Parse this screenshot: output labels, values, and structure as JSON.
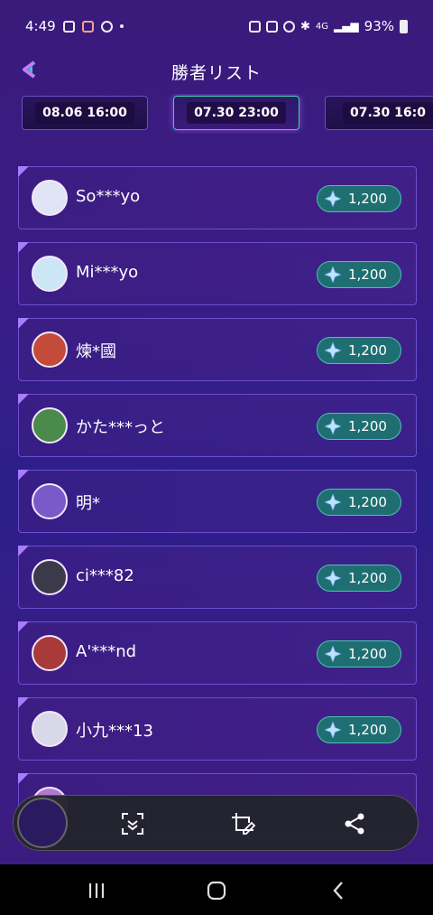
{
  "status_bar": {
    "time": "4:49",
    "battery": "93%",
    "network": "4G"
  },
  "header": {
    "title": "勝者リスト"
  },
  "tabs": [
    "08.06 16:00",
    "07.30 23:00",
    "07.30 16:0"
  ],
  "winners": [
    {
      "name": "So***yo",
      "prize": "1,200",
      "avatar_color": "#e0e4f4"
    },
    {
      "name": "Mi***yo",
      "prize": "1,200",
      "avatar_color": "#cde6f5"
    },
    {
      "name": "煉*國",
      "prize": "1,200",
      "avatar_color": "#c44a3a"
    },
    {
      "name": "かた***っと",
      "prize": "1,200",
      "avatar_color": "#4a8a4a"
    },
    {
      "name": "明*",
      "prize": "1,200",
      "avatar_color": "#7a5ac8"
    },
    {
      "name": "ci***82",
      "prize": "1,200",
      "avatar_color": "#3a3a4a"
    },
    {
      "name": "A'***nd",
      "prize": "1,200",
      "avatar_color": "#a83a3a"
    },
    {
      "name": "小九***13",
      "prize": "1,200",
      "avatar_color": "#d8d8e8"
    },
    {
      "name": "",
      "prize": "",
      "avatar_color": "#b07ad0"
    }
  ],
  "toolbar": {
    "items": [
      "capture-scroll",
      "crop-edit",
      "share"
    ]
  },
  "colors": {
    "accent": "#4bc3b3",
    "border": "#6d4fd0",
    "active_tab": "#3fd1a9"
  }
}
